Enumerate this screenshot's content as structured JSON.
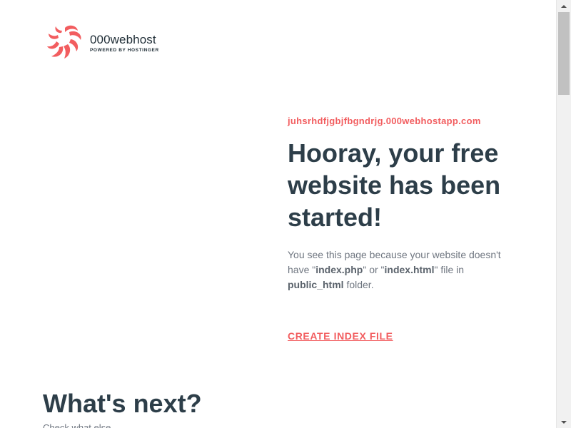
{
  "brand": {
    "name": "000webhost",
    "tagline": "POWERED BY HOSTINGER",
    "accent_color": "#f25d5f",
    "logo_icon": "000webhost-swirl-logo"
  },
  "hero": {
    "domain": "juhsrhdfjgbjfbgndrjg.000webhostapp.com",
    "headline": "Hooray, your free website has been started!",
    "desc_1": "You see this page because your website doesn't have \"",
    "desc_file1": "index.php",
    "desc_2": "\" or \"",
    "desc_file2": "index.html",
    "desc_3": "\" file in ",
    "desc_folder": "public_html",
    "desc_4": " folder.",
    "cta_label": "CREATE INDEX FILE"
  },
  "next": {
    "title": "What's next?",
    "subtitle": "Check what else..."
  },
  "colors": {
    "heading": "#2d3e49",
    "body_text": "#6f7680"
  }
}
